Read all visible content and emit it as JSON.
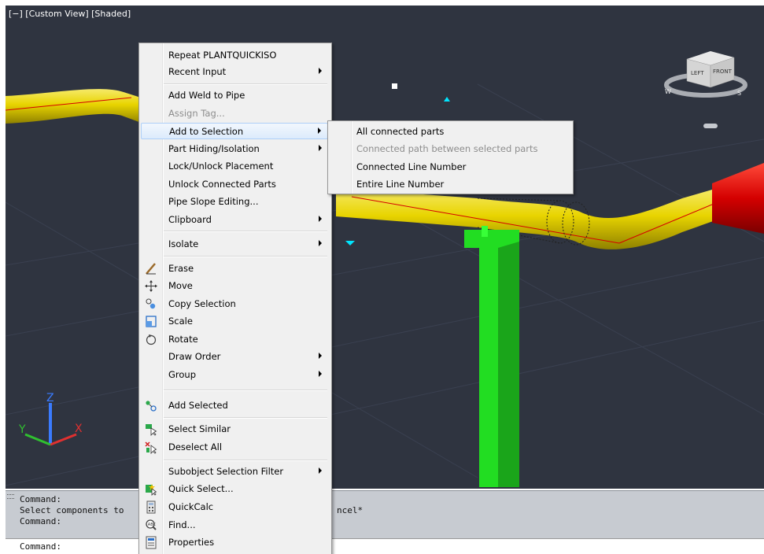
{
  "viewport": {
    "label": "[−] [Custom View] [Shaded]",
    "viewcube": {
      "left_face": "LEFT",
      "front_face": "FRONT",
      "compass_w": "W",
      "compass_s": "S"
    },
    "ucs_axes": {
      "x": "X",
      "y": "Y",
      "z": "Z"
    }
  },
  "context_menu": {
    "items": [
      {
        "label": "Repeat PLANTQUICKISO"
      },
      {
        "label": "Recent Input"
      },
      {
        "label": "Add Weld to Pipe"
      },
      {
        "label": "Assign Tag..."
      },
      {
        "label": "Add to Selection"
      },
      {
        "label": "Part Hiding/Isolation"
      },
      {
        "label": "Lock/Unlock Placement"
      },
      {
        "label": "Unlock Connected Parts"
      },
      {
        "label": "Pipe Slope Editing..."
      },
      {
        "label": "Clipboard"
      },
      {
        "label": "Isolate"
      },
      {
        "label": "Erase",
        "icon": "eraser-icon"
      },
      {
        "label": "Move",
        "icon": "move-icon"
      },
      {
        "label": "Copy Selection",
        "icon": "copy-icon"
      },
      {
        "label": "Scale",
        "icon": "scale-icon"
      },
      {
        "label": "Rotate",
        "icon": "rotate-icon"
      },
      {
        "label": "Draw Order"
      },
      {
        "label": "Group"
      },
      {
        "label": "Add Selected",
        "icon": "add-selected-icon"
      },
      {
        "label": "Select Similar",
        "icon": "select-similar-icon"
      },
      {
        "label": "Deselect All",
        "icon": "deselect-all-icon"
      },
      {
        "label": "Subobject Selection Filter"
      },
      {
        "label": "Quick Select...",
        "icon": "quick-select-icon"
      },
      {
        "label": "QuickCalc",
        "icon": "calculator-icon"
      },
      {
        "label": "Find...",
        "icon": "find-icon"
      },
      {
        "label": "Properties",
        "icon": "properties-icon"
      }
    ]
  },
  "submenu": {
    "items": [
      {
        "label": "All connected parts"
      },
      {
        "label": "Connected path between selected parts"
      },
      {
        "label": "Connected Line Number"
      },
      {
        "label": "Entire Line Number"
      }
    ]
  },
  "command": {
    "line1": "Command:",
    "line2a": "Select components to ",
    "line2b": "ncel*",
    "line3": "Command:",
    "input_prompt": "Command:"
  },
  "colors": {
    "viewport_bg": "#2f3440",
    "pipe_yellow": "#e8d800",
    "pipe_red": "#d00000",
    "support_green": "#22dd22",
    "menu_bg": "#f0f0f0",
    "highlight": "#dcebfc"
  }
}
